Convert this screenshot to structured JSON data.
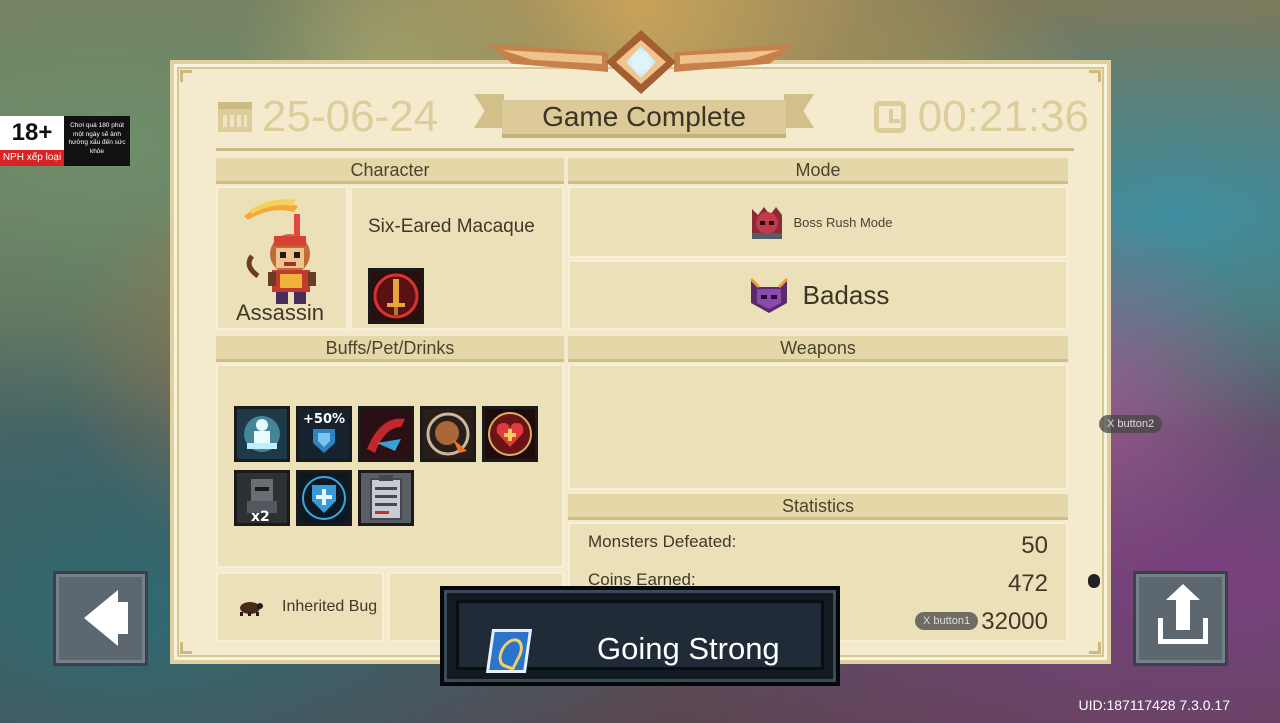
{
  "age_rating": {
    "label": "18+",
    "publisher": "NPH xếp loại",
    "warning": "Chơi quá 180 phút một ngày sẽ ảnh hưởng xấu đến sức khỏe"
  },
  "header": {
    "title": "Game Complete",
    "date": "25-06-24",
    "time": "00:21:36"
  },
  "character": {
    "section_title": "Character",
    "name": "Six-Eared Macaque",
    "class": "Assassin",
    "skill_icon": "sword-skill-icon"
  },
  "mode": {
    "section_title": "Mode",
    "game_mode": "Boss Rush Mode",
    "difficulty": "Badass"
  },
  "buffs": {
    "section_title": "Buffs/Pet/Drinks",
    "items": [
      {
        "icon": "meditation-buff-icon"
      },
      {
        "icon": "shield-50-percent-buff-icon",
        "text": "+50%"
      },
      {
        "icon": "red-slash-buff-icon"
      },
      {
        "icon": "dash-buff-icon"
      },
      {
        "icon": "heart-buff-icon"
      },
      {
        "icon": "knight-x2-buff-icon",
        "text": "x2"
      },
      {
        "icon": "blue-shield-buff-icon"
      },
      {
        "icon": "checklist-buff-icon"
      }
    ],
    "pet_label": "Inherited Bug"
  },
  "weapons": {
    "section_title": "Weapons"
  },
  "statistics": {
    "section_title": "Statistics",
    "rows": [
      {
        "label": "Monsters Defeated:",
        "value": "50"
      },
      {
        "label": "Coins Earned:",
        "value": "472"
      },
      {
        "label": "",
        "value": "32000"
      }
    ]
  },
  "banner": {
    "text": "Going Strong"
  },
  "controls": {
    "xbutton1": "X button1",
    "xbutton2": "X button2"
  },
  "footer": {
    "uid": "UID:187117428 7.3.0.17"
  },
  "colors": {
    "panel_bg": "#f4ebcf",
    "header_text": "#dccd9b",
    "banner_bg": "#1f2b36"
  }
}
